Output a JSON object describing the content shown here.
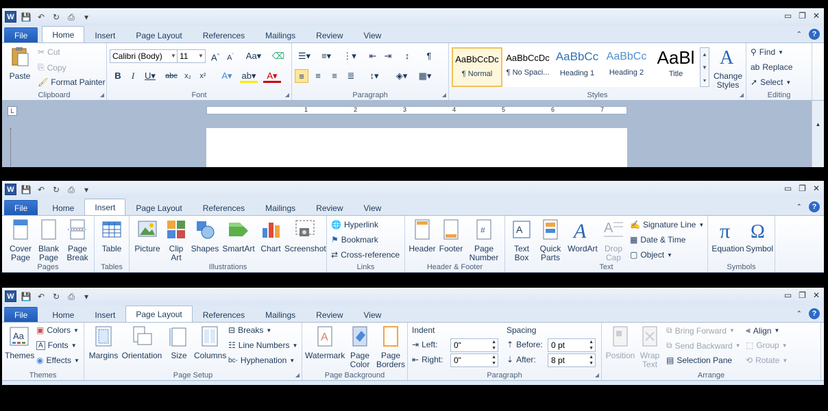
{
  "home_window": {
    "tabs": [
      "File",
      "Home",
      "Insert",
      "Page Layout",
      "References",
      "Mailings",
      "Review",
      "View"
    ],
    "active_tab": "Home",
    "clipboard": {
      "paste": "Paste",
      "cut": "Cut",
      "copy": "Copy",
      "format_painter": "Format Painter",
      "label": "Clipboard"
    },
    "font": {
      "name": "Calibri (Body)",
      "size": "11",
      "label": "Font"
    },
    "paragraph": {
      "label": "Paragraph"
    },
    "styles": {
      "items": [
        {
          "preview": "AaBbCcDc",
          "name": "¶ Normal"
        },
        {
          "preview": "AaBbCcDc",
          "name": "¶ No Spaci..."
        },
        {
          "preview": "AaBbCc",
          "name": "Heading 1"
        },
        {
          "preview": "AaBbCc",
          "name": "Heading 2"
        },
        {
          "preview": "AaBl",
          "name": "Title"
        }
      ],
      "change_styles": "Change Styles",
      "label": "Styles"
    },
    "editing": {
      "find": "Find",
      "replace": "Replace",
      "select": "Select",
      "label": "Editing"
    },
    "ruler_numbers": [
      "1",
      "2",
      "3",
      "4",
      "5",
      "6",
      "7"
    ]
  },
  "insert_window": {
    "tabs": [
      "File",
      "Home",
      "Insert",
      "Page Layout",
      "References",
      "Mailings",
      "Review",
      "View"
    ],
    "active_tab": "Insert",
    "pages": {
      "cover": "Cover Page",
      "blank": "Blank Page",
      "break": "Page Break",
      "label": "Pages"
    },
    "tables": {
      "table": "Table",
      "label": "Tables"
    },
    "illustrations": {
      "picture": "Picture",
      "clipart": "Clip Art",
      "shapes": "Shapes",
      "smartart": "SmartArt",
      "chart": "Chart",
      "screenshot": "Screenshot",
      "label": "Illustrations"
    },
    "links": {
      "hyperlink": "Hyperlink",
      "bookmark": "Bookmark",
      "crossref": "Cross-reference",
      "label": "Links"
    },
    "header_footer": {
      "header": "Header",
      "footer": "Footer",
      "page_number": "Page Number",
      "label": "Header & Footer"
    },
    "text": {
      "textbox": "Text Box",
      "quickparts": "Quick Parts",
      "wordart": "WordArt",
      "dropcap": "Drop Cap",
      "signature": "Signature Line",
      "datetime": "Date & Time",
      "object": "Object",
      "label": "Text"
    },
    "symbols": {
      "equation": "Equation",
      "symbol": "Symbol",
      "label": "Symbols"
    }
  },
  "layout_window": {
    "tabs": [
      "File",
      "Home",
      "Insert",
      "Page Layout",
      "References",
      "Mailings",
      "Review",
      "View"
    ],
    "active_tab": "Page Layout",
    "themes": {
      "themes": "Themes",
      "colors": "Colors",
      "fonts": "Fonts",
      "effects": "Effects",
      "label": "Themes"
    },
    "page_setup": {
      "margins": "Margins",
      "orientation": "Orientation",
      "size": "Size",
      "columns": "Columns",
      "breaks": "Breaks",
      "line_numbers": "Line Numbers",
      "hyphenation": "Hyphenation",
      "label": "Page Setup"
    },
    "page_background": {
      "watermark": "Watermark",
      "page_color": "Page Color",
      "page_borders": "Page Borders",
      "label": "Page Background"
    },
    "paragraph": {
      "indent": "Indent",
      "left_label": "Left:",
      "left_value": "0\"",
      "right_label": "Right:",
      "right_value": "0\"",
      "spacing": "Spacing",
      "before_label": "Before:",
      "before_value": "0 pt",
      "after_label": "After:",
      "after_value": "8 pt",
      "label": "Paragraph"
    },
    "arrange": {
      "position": "Position",
      "wrap_text": "Wrap Text",
      "bring_forward": "Bring Forward",
      "send_backward": "Send Backward",
      "selection_pane": "Selection Pane",
      "align": "Align",
      "group": "Group",
      "rotate": "Rotate",
      "label": "Arrange"
    }
  }
}
